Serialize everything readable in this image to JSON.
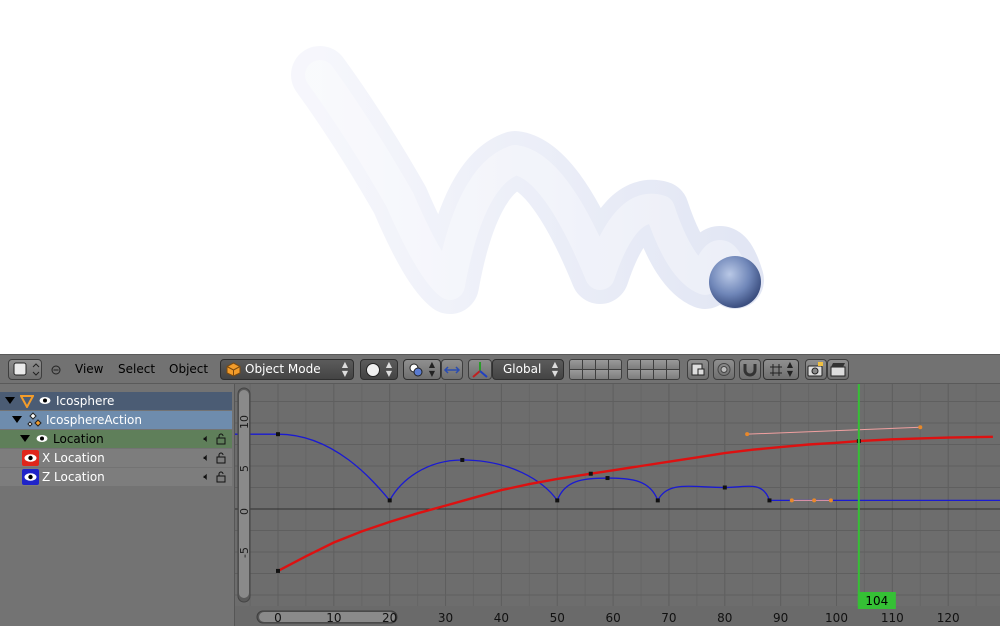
{
  "toolbar": {
    "menus": [
      "View",
      "Select",
      "Object"
    ],
    "mode": "Object Mode",
    "orientation": "Global"
  },
  "channels": {
    "object": "Icosphere",
    "action": "IcosphereAction",
    "group": "Location",
    "items": [
      {
        "label": "X Location",
        "color": "#e0261b"
      },
      {
        "label": "Z Location",
        "color": "#1f24c9"
      }
    ]
  },
  "graph": {
    "current_frame": "104",
    "x_ticks": [
      "0",
      "10",
      "20",
      "30",
      "40",
      "50",
      "60",
      "70",
      "80",
      "90",
      "100",
      "110",
      "120"
    ],
    "y_ticks": [
      "10",
      "5",
      "0",
      "-5"
    ],
    "colors": {
      "x_curve": "#dd1111",
      "z_curve": "#1a1ad2",
      "playhead": "#35c035",
      "background": "#6d6d6d"
    }
  },
  "chart_data": {
    "type": "line",
    "xlabel": "",
    "ylabel": "",
    "xlim": [
      -3,
      130
    ],
    "ylim": [
      -8.5,
      10.8
    ],
    "grid": true,
    "current_frame": 104,
    "series": [
      {
        "points": [
          [
            0,
            -7.2
          ],
          [
            5,
            -5.5
          ],
          [
            10,
            -3.9
          ],
          [
            15,
            -2.6
          ],
          [
            20,
            -1.5
          ],
          [
            25,
            -0.5
          ],
          [
            30,
            0.4
          ],
          [
            35,
            1.3
          ],
          [
            40,
            2.2
          ],
          [
            45,
            2.9
          ],
          [
            50,
            3.5
          ],
          [
            56,
            4.1
          ],
          [
            60,
            4.5
          ],
          [
            65,
            5.0
          ],
          [
            70,
            5.5
          ],
          [
            75,
            6.0
          ],
          [
            80,
            6.5
          ],
          [
            85,
            6.9
          ],
          [
            90,
            7.2
          ],
          [
            95,
            7.5
          ],
          [
            100,
            7.7
          ],
          [
            104,
            7.9
          ],
          [
            110,
            8.1
          ],
          [
            120,
            8.3
          ],
          [
            128,
            8.4
          ]
        ],
        "keyframes": [
          [
            0,
            -7.2
          ],
          [
            56,
            4.1
          ],
          [
            104,
            7.9
          ]
        ],
        "color": "#dd1111"
      },
      {
        "points": [
          [
            0,
            8.7
          ],
          [
            20,
            1.0
          ],
          [
            33,
            5.7
          ],
          [
            50,
            1.0
          ],
          [
            59,
            3.6
          ],
          [
            68,
            1.0
          ],
          [
            80,
            2.5
          ],
          [
            88,
            1.0
          ],
          [
            92,
            1.0
          ],
          [
            130,
            1.0
          ]
        ],
        "keyframes": [
          [
            0,
            8.7
          ],
          [
            20,
            1.0
          ],
          [
            33,
            5.7
          ],
          [
            50,
            1.0
          ],
          [
            59,
            3.6
          ],
          [
            68,
            1.0
          ],
          [
            80,
            2.5
          ],
          [
            88,
            1.0
          ]
        ],
        "color": "#1a1ad2"
      }
    ]
  }
}
